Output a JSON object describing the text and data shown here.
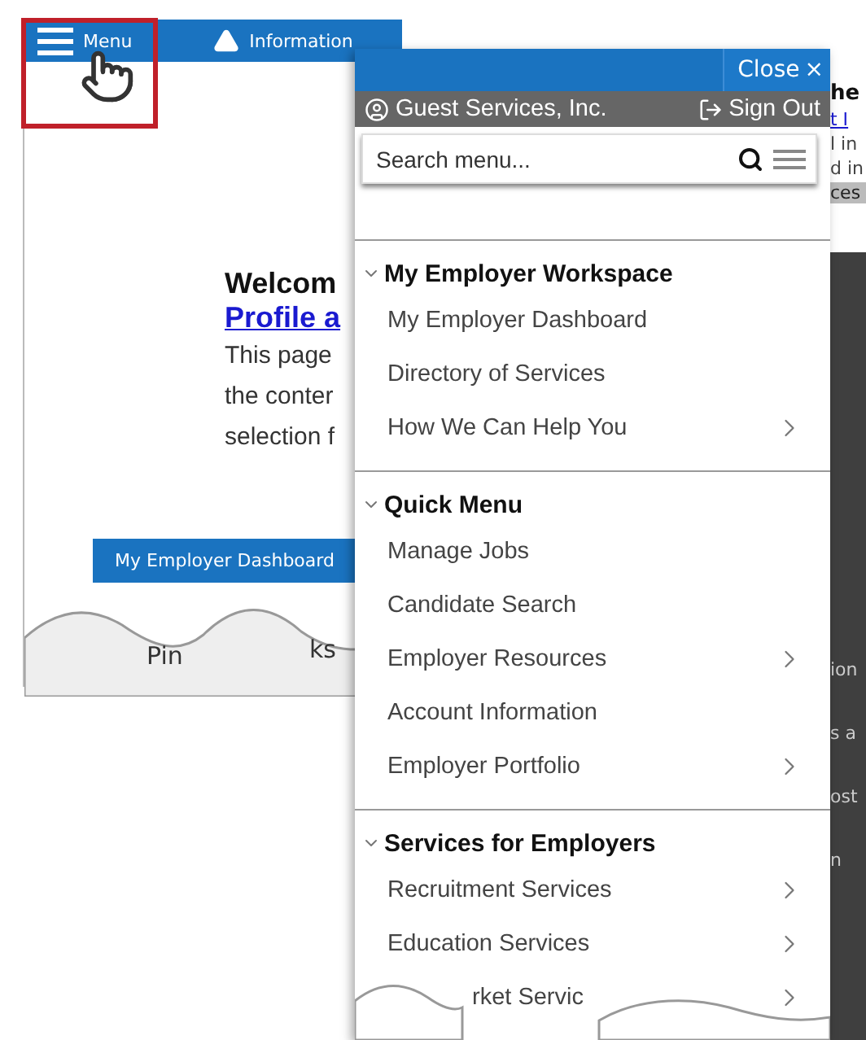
{
  "back_page": {
    "top_bar": {
      "buttons": [
        {
          "kind": "menu",
          "label": "Menu",
          "highlighted": true
        },
        {
          "kind": "information",
          "label": "Information",
          "highlighted": false
        }
      ]
    },
    "welcome": {
      "heading": "Welcom",
      "link": "Profile a",
      "lines": [
        "This page",
        "the conter",
        "selection f"
      ]
    },
    "dashboard_tab": "My Employer Dashboard",
    "pinned": [
      "Pin",
      "ks"
    ]
  },
  "side_page": {
    "fragments": [
      {
        "text": "he",
        "kind": "bold"
      },
      {
        "text": "t I",
        "kind": "link"
      },
      {
        "text": "l in",
        "kind": "plain"
      },
      {
        "text": "d in",
        "kind": "plain"
      },
      {
        "text": "ces",
        "kind": "band"
      },
      {
        "text": "ion",
        "kind": "dark"
      },
      {
        "text": "s a",
        "kind": "dark"
      },
      {
        "text": "ost",
        "kind": "dark"
      },
      {
        "text": "n",
        "kind": "dark"
      }
    ]
  },
  "menu": {
    "close_label": "Close",
    "close_glyph": "×",
    "account": "Guest Services, Inc.",
    "sign_out": "Sign Out",
    "search": {
      "placeholder": "Search menu..."
    },
    "sections": [
      {
        "title": "My Employer Workspace",
        "expanded": true,
        "items": [
          {
            "label": "My Employer Dashboard",
            "has_submenu": false,
            "partial": false
          },
          {
            "label": "Directory of Services",
            "has_submenu": false,
            "partial": false
          },
          {
            "label": "How We Can Help You",
            "has_submenu": true,
            "partial": false
          }
        ]
      },
      {
        "title": "Quick Menu",
        "expanded": true,
        "items": [
          {
            "label": "Manage Jobs",
            "has_submenu": false,
            "partial": false
          },
          {
            "label": "Candidate Search",
            "has_submenu": false,
            "partial": false
          },
          {
            "label": "Employer Resources",
            "has_submenu": true,
            "partial": false
          },
          {
            "label": "Account Information",
            "has_submenu": false,
            "partial": false
          },
          {
            "label": "Employer Portfolio",
            "has_submenu": true,
            "partial": false
          }
        ]
      },
      {
        "title": "Services for Employers",
        "expanded": true,
        "items": [
          {
            "label": "Recruitment Services",
            "has_submenu": true,
            "partial": false
          },
          {
            "label": "Education Services",
            "has_submenu": true,
            "partial": false
          },
          {
            "label": "rket Servic",
            "has_submenu": true,
            "partial": true
          }
        ]
      }
    ]
  }
}
